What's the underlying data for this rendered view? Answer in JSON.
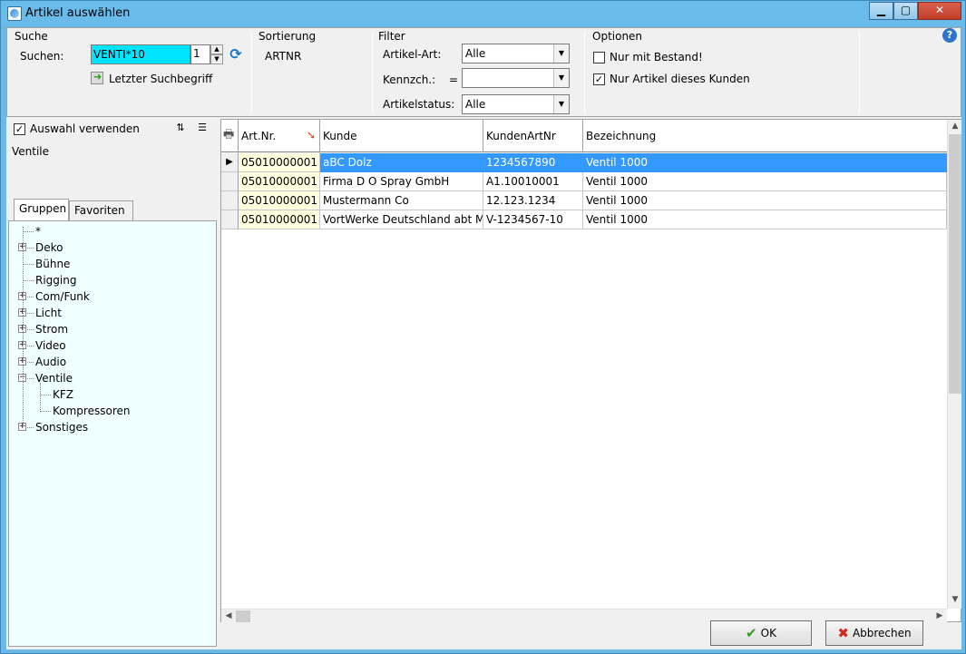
{
  "window": {
    "title": "Artikel auswählen"
  },
  "search": {
    "group_title": "Suche",
    "label": "Suchen:",
    "value": "VENTI*10",
    "spin_value": "1",
    "last_search_label": "Letzter Suchbegriff"
  },
  "sorting": {
    "group_title": "Sortierung",
    "value": "ARTNR"
  },
  "filter": {
    "group_title": "Filter",
    "article_type_label": "Artikel-Art:",
    "article_type_value": "Alle",
    "code_label": "Kennzch.:",
    "code_operator": "=",
    "code_value": "",
    "status_label": "Artikelstatus:",
    "status_value": "Alle"
  },
  "options": {
    "group_title": "Optionen",
    "only_stock_label": "Nur mit Bestand!",
    "only_stock_checked": false,
    "only_customer_label": "Nur Artikel dieses Kunden",
    "only_customer_checked": true
  },
  "left_panel": {
    "use_selection_label": "Auswahl verwenden",
    "use_selection_checked": true,
    "selected_group": "Ventile",
    "tabs": [
      "Gruppen",
      "Favoriten"
    ],
    "active_tab": "Gruppen",
    "tree": [
      {
        "label": "*",
        "level": 0,
        "expander": ""
      },
      {
        "label": "Deko",
        "level": 0,
        "expander": "+"
      },
      {
        "label": "Bühne",
        "level": 0,
        "expander": ""
      },
      {
        "label": "Rigging",
        "level": 0,
        "expander": ""
      },
      {
        "label": "Com/Funk",
        "level": 0,
        "expander": "+"
      },
      {
        "label": "Licht",
        "level": 0,
        "expander": "+"
      },
      {
        "label": "Strom",
        "level": 0,
        "expander": "+"
      },
      {
        "label": "Video",
        "level": 0,
        "expander": "+"
      },
      {
        "label": "Audio",
        "level": 0,
        "expander": "+"
      },
      {
        "label": "Ventile",
        "level": 0,
        "expander": "-"
      },
      {
        "label": "KFZ",
        "level": 1,
        "expander": ""
      },
      {
        "label": "Kompressoren",
        "level": 1,
        "expander": ""
      },
      {
        "label": "Sonstiges",
        "level": 0,
        "expander": "+"
      }
    ]
  },
  "grid": {
    "columns": [
      "Art.Nr.",
      "Kunde",
      "KundenArtNr",
      "Bezeichnung"
    ],
    "rows": [
      {
        "art_nr": "05010000001",
        "kunde": "aBC Dolz",
        "kunden_art_nr": "1234567890",
        "bezeichnung": "Ventil 1000",
        "selected": true
      },
      {
        "art_nr": "05010000001",
        "kunde": "Firma D O Spray GmbH",
        "kunden_art_nr": "A1.10010001",
        "bezeichnung": "Ventil 1000",
        "selected": false
      },
      {
        "art_nr": "05010000001",
        "kunde": "Mustermann  Co",
        "kunden_art_nr": "12.123.1234",
        "bezeichnung": "Ventil 1000",
        "selected": false
      },
      {
        "art_nr": "05010000001",
        "kunde": "VortWerke Deutschland  abt M",
        "kunden_art_nr": "V-1234567-10",
        "bezeichnung": "Ventil 1000",
        "selected": false
      }
    ]
  },
  "buttons": {
    "ok_label": "OK",
    "cancel_label": "Abbrechen"
  },
  "colors": {
    "search_highlight": "#00e5ff",
    "selection": "#3399ff",
    "tree_background": "#f0ffff",
    "artnr_background": "#ffffe0"
  }
}
